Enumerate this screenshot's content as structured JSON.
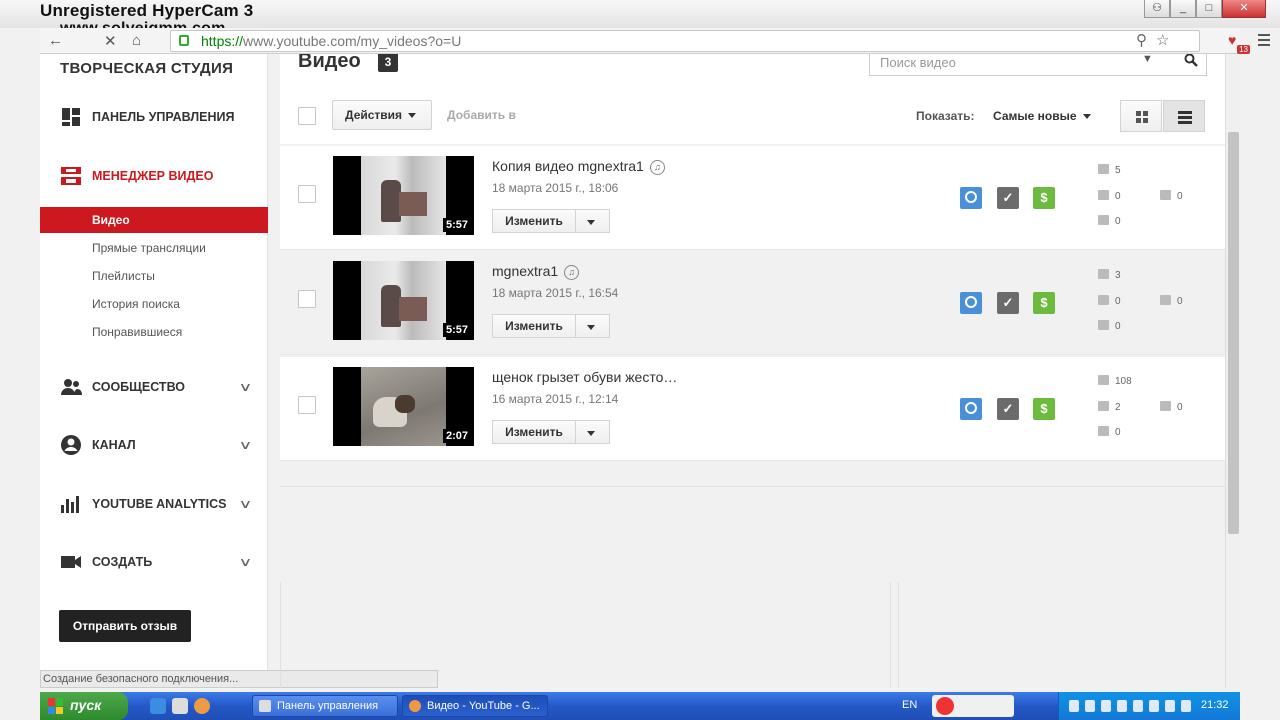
{
  "watermark": {
    "line1": "Unregistered HyperCam 3",
    "line2": "www.solveigmm.com"
  },
  "browser": {
    "url_scheme": "https://",
    "url_rest": "www.youtube.com/my_videos?o=U",
    "extension_badge": "13"
  },
  "sidebar": {
    "studio_title": "ТВОРЧЕСКАЯ СТУДИЯ",
    "dashboard": "ПАНЕЛЬ УПРАВЛЕНИЯ",
    "video_manager": "МЕНЕДЖЕР ВИДЕО",
    "sub_items": [
      "Видео",
      "Прямые трансляции",
      "Плейлисты",
      "История поиска",
      "Понравившиеся"
    ],
    "community": "СООБЩЕСТВО",
    "channel": "КАНАЛ",
    "analytics": "YOUTUBE ANALYTICS",
    "create": "СОЗДАТЬ",
    "feedback": "Отправить отзыв",
    "status": "Создание безопасного подключения..."
  },
  "main": {
    "title": "Видео",
    "count": "3",
    "search_placeholder": "Поиск видео",
    "actions": "Действия",
    "add_to": "Добавить в",
    "sort_label": "Показать:",
    "sort_value": "Самые новые",
    "edit_label": "Изменить"
  },
  "videos": [
    {
      "title": "Копия видео mgnextra1",
      "date": "18 марта 2015 г., 18:06",
      "duration": "5:57",
      "views": "5",
      "likes": "0",
      "comments": "0",
      "dislikes": "0"
    },
    {
      "title": "mgnextra1",
      "date": "18 марта 2015 г., 16:54",
      "duration": "5:57",
      "views": "3",
      "likes": "0",
      "comments": "0",
      "dislikes": "0"
    },
    {
      "title": "щенок грызет обуви жесто…",
      "date": "16 марта 2015 г., 12:14",
      "duration": "2:07",
      "views": "108",
      "likes": "2",
      "comments": "0",
      "dislikes": "0"
    }
  ],
  "taskbar": {
    "start": "пуск",
    "tasks": [
      "Панель управления",
      "Видео - YouTube - G..."
    ],
    "lang": "EN",
    "time": "21:32"
  },
  "colors": {
    "accent": "#cc181e",
    "public": "#4a90d9",
    "monetized": "#6cba3e"
  }
}
